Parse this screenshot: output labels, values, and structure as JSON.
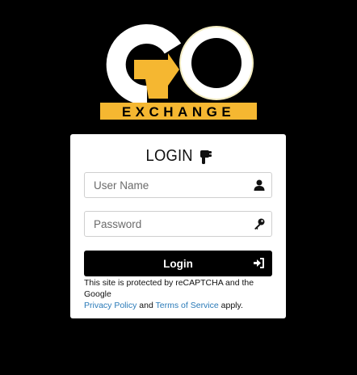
{
  "logo": {
    "text": "GO",
    "subtitle": "EXCHANGE",
    "accent_color": "#f5b731",
    "ring_color": "#f3ecc2"
  },
  "login_form": {
    "title": "LOGIN",
    "title_icon": "hand-pointer-icon",
    "username": {
      "placeholder": "User Name",
      "value": "",
      "icon": "user-icon"
    },
    "password": {
      "placeholder": "Password",
      "value": "",
      "icon": "key-icon"
    },
    "submit_label": "Login",
    "submit_icon": "sign-in-icon"
  },
  "recaptcha_notice": {
    "prefix": "This site is protected by reCAPTCHA and the Google",
    "privacy_link": "Privacy Policy",
    "and": "and",
    "terms_link": "Terms of Service",
    "suffix": "apply."
  },
  "colors": {
    "background": "#000000",
    "card": "#ffffff",
    "button": "#000000",
    "link": "#2a7ab8"
  }
}
